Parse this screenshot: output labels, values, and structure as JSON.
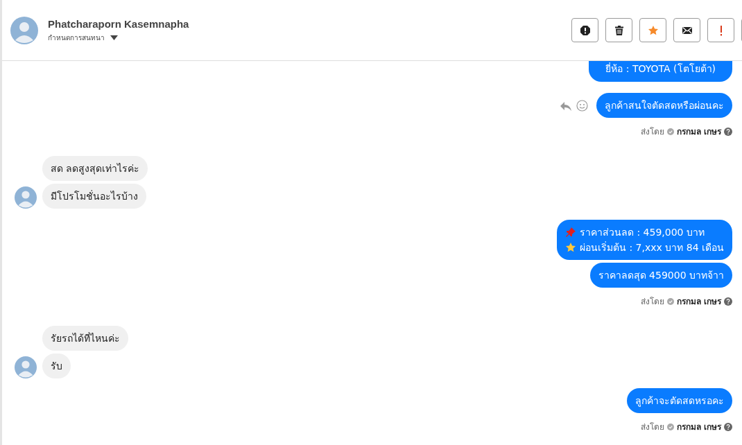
{
  "header": {
    "name": "Phatcharaporn Kasemnapha",
    "subtitle": "กำหนดการสนทนา"
  },
  "groups": [
    {
      "kind": "outgoing",
      "bubbles": [
        {
          "cut_top": true,
          "lines": [
            {
              "text": "ยี่ห้อ : TOYOTA (โตโยต้า)"
            }
          ]
        }
      ]
    },
    {
      "kind": "outgoing",
      "actions": true,
      "bubbles": [
        {
          "lines": [
            {
              "text": "ลูกค้าสนใจตัดสดหรือผ่อนคะ"
            }
          ]
        }
      ],
      "sent_by": {
        "label": "ส่งโดย",
        "name": "กรกมล เกษร"
      }
    },
    {
      "kind": "incoming",
      "bubbles": [
        {
          "lines": [
            {
              "text": "สด ลดสูงสุดเท่าไรค่ะ"
            }
          ]
        },
        {
          "lines": [
            {
              "text": "มีโปรโมชั่นอะไรบ้าง"
            }
          ]
        }
      ]
    },
    {
      "kind": "outgoing",
      "bubbles": [
        {
          "lines": [
            {
              "kind": "pin",
              "text": "ราคาส่วนลด : 459,000 บาท"
            },
            {
              "kind": "star",
              "text": "ผ่อนเริ่มต้น : 7,xxx บาท 84 เดือน"
            }
          ]
        },
        {
          "lines": [
            {
              "text": "ราคาลดสุด 459000 บาทจ้าา"
            }
          ]
        }
      ],
      "sent_by": {
        "label": "ส่งโดย",
        "name": "กรกมล เกษร"
      }
    },
    {
      "kind": "incoming",
      "bubbles": [
        {
          "lines": [
            {
              "text": "รัยรถได้ที่ไหนค่ะ"
            }
          ]
        },
        {
          "lines": [
            {
              "text": "รับ"
            }
          ]
        }
      ]
    },
    {
      "kind": "outgoing",
      "bubbles": [
        {
          "lines": [
            {
              "text": "ลูกค้าจะตัดสดหรอคะ"
            }
          ]
        }
      ],
      "sent_by": {
        "label": "ส่งโดย",
        "name": "กรกมล เกษร"
      }
    }
  ]
}
